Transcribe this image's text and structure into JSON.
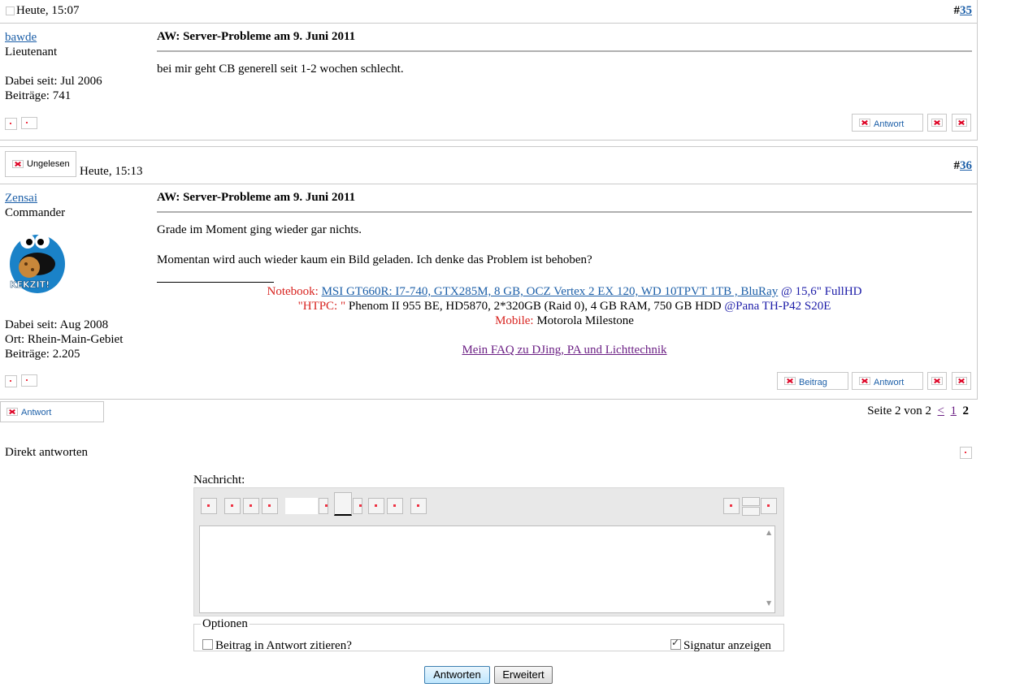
{
  "posts": [
    {
      "time": "Heute, 15:07",
      "number_prefix": "#",
      "number": "35",
      "user": "bawde",
      "rank": "Lieutenant",
      "joined": "Dabei seit: Jul 2006",
      "posts": "Beiträge: 741",
      "title": "AW: Server-Probleme am 9. Juni 2011",
      "message": "bei mir geht CB generell seit 1-2 wochen schlecht.",
      "reply_label": "Antwort"
    },
    {
      "unread_label": "Ungelesen",
      "time": "Heute, 15:13",
      "number_prefix": "#",
      "number": "36",
      "user": "Zensai",
      "rank": "Commander",
      "avatar_text": "KEKZIT!",
      "joined": "Dabei seit: Aug 2008",
      "location": "Ort: Rhein-Main-Gebiet",
      "posts": "Beiträge: 2.205",
      "title": "AW: Server-Probleme am 9. Juni 2011",
      "message_1": "Grade im Moment ging wieder gar nichts.",
      "message_2": "Momentan wird auch wieder kaum ein Bild geladen. Ich denke das Problem ist behoben?",
      "signature": {
        "notebook_label": "Notebook:",
        "notebook_link": "MSI GT660R: I7-740, GTX285M, 8 GB, OCZ Vertex 2 EX 120, WD 10TPVT 1TB , BluRay",
        "notebook_tail": "@ 15,6\" FullHD",
        "htpc_label": "\"HTPC: \"",
        "htpc_text": "Phenom II 955 BE, HD5870, 2*320GB (Raid 0), 4 GB RAM, 750 GB HDD",
        "htpc_tail": "@Pana TH-P42 S20E",
        "mobile_label": "Mobile:",
        "mobile_text": "Motorola Milestone",
        "faq_link": "Mein FAQ zu DJing, PA und Lichttechnik"
      },
      "quote_label": "Beitrag",
      "reply_label": "Antwort"
    }
  ],
  "bottom_reply_label": "Antwort",
  "pagination": {
    "text": "Seite 2 von 2",
    "prev": "<",
    "page1": "1",
    "current": "2"
  },
  "quick_reply": {
    "title": "Direkt antworten",
    "message_label": "Nachricht:",
    "options_legend": "Optionen",
    "quote_option": "Beitrag in Antwort zitieren?",
    "quote_checked": false,
    "signature_option": "Signatur anzeigen",
    "signature_checked": true,
    "submit_label": "Antworten",
    "advanced_label": "Erweitert"
  }
}
